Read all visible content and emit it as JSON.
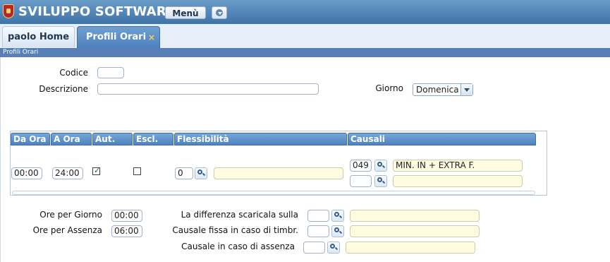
{
  "header": {
    "brand": "SVILUPPO SOFTWARE",
    "menu_button": "Menù"
  },
  "tabs": [
    {
      "label": "paolo Home"
    },
    {
      "label": "Profili Orari",
      "close": "×"
    }
  ],
  "strip_title": "Profili Orari",
  "form": {
    "codice_label": "Codice",
    "codice_value": "",
    "descrizione_label": "Descrizione",
    "descrizione_value": "",
    "giorno_label": "Giorno",
    "giorno_value": "Domenica"
  },
  "grid": {
    "headers": [
      "Da Ora",
      "A Ora",
      "Aut.",
      "Escl.",
      "Flessibilità",
      "Causali"
    ],
    "row": {
      "da_ora": "00:00",
      "a_ora": "24:00",
      "aut_checked": true,
      "escl_checked": false,
      "flessibilita_code": "0",
      "flessibilita_desc": "",
      "causali": [
        {
          "code": "049",
          "desc": "MIN. IN + EXTRA F."
        },
        {
          "code": "",
          "desc": ""
        }
      ]
    }
  },
  "bottom": {
    "ore_giorno_label": "Ore per Giorno",
    "ore_giorno_value": "00:00",
    "ore_assenza_label": "Ore per Assenza",
    "ore_assenza_value": "06:00",
    "differenza_label": "La differenza scaricala sulla",
    "differenza_code": "",
    "differenza_desc": "",
    "fissa_label": "Causale fissa in caso di timbr.",
    "fissa_code": "",
    "fissa_desc": "",
    "assenza_label": "Causale in caso di assenza",
    "assenza_code": "",
    "assenza_desc": ""
  },
  "colors": {
    "header": "#4f82b8",
    "active_tab": "#5b8fca",
    "yellow_field": "#fffbe0"
  }
}
